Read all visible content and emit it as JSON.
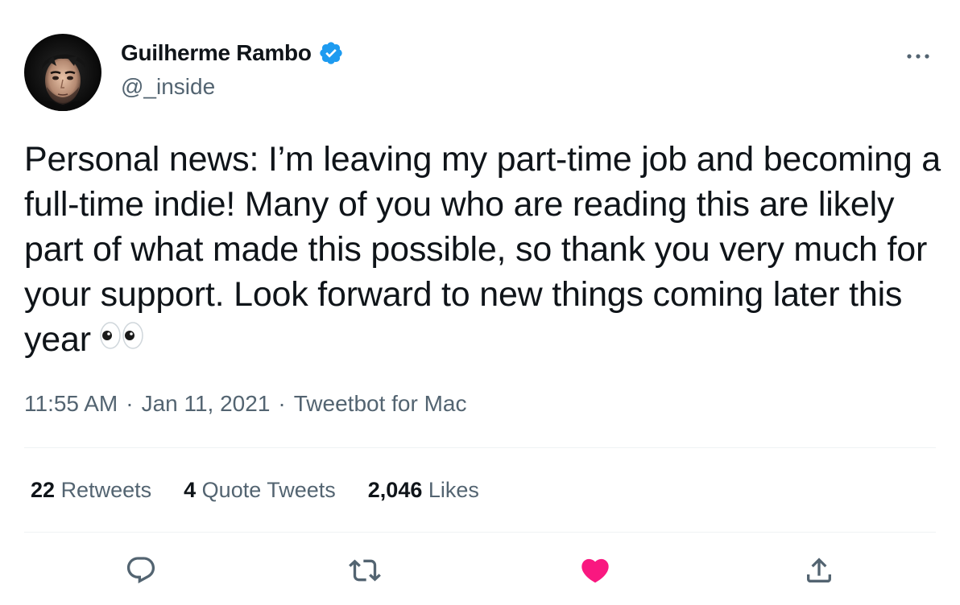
{
  "author": {
    "name": "Guilherme Rambo",
    "handle": "@_inside",
    "verified_icon": "verified-badge-icon"
  },
  "tweet": {
    "text": "Personal news: I’m leaving my part-time job and becoming a full-time indie! Many of you who are reading this are likely part of what made this possible, so thank you very much for your support. Look forward to new things coming later this year",
    "emoji": "👀"
  },
  "meta": {
    "time": "11:55 AM",
    "date": "Jan 11, 2021",
    "source": "Tweetbot for Mac",
    "separator": "·"
  },
  "stats": {
    "retweets_count": "22",
    "retweets_label": "Retweets",
    "quotes_count": "4",
    "quotes_label": "Quote Tweets",
    "likes_count": "2,046",
    "likes_label": "Likes"
  },
  "actions": {
    "reply_icon": "reply-icon",
    "retweet_icon": "retweet-icon",
    "like_icon": "like-icon",
    "share_icon": "share-icon",
    "like_color": "#f91880",
    "icon_color": "#536471"
  },
  "colors": {
    "verified": "#1d9bf0",
    "text": "#0f1419",
    "secondary": "#536471",
    "divider": "#eff3f4"
  }
}
